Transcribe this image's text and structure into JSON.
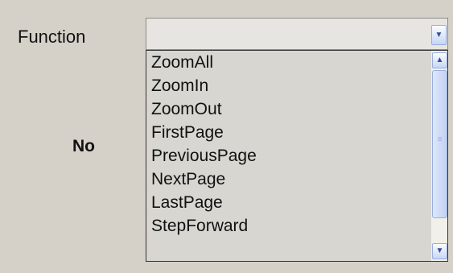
{
  "labels": {
    "function": "Function",
    "no": "No"
  },
  "combo": {
    "selected_value": "",
    "arrow_icon": "chevron-down-icon"
  },
  "dropdown": {
    "items": [
      "ZoomAll",
      "ZoomIn",
      "ZoomOut",
      "FirstPage",
      "PreviousPage",
      "NextPage",
      "LastPage",
      "StepForward"
    ]
  },
  "scrollbar": {
    "up_icon": "chevron-up-icon",
    "down_icon": "chevron-down-icon",
    "grip": "≡"
  }
}
